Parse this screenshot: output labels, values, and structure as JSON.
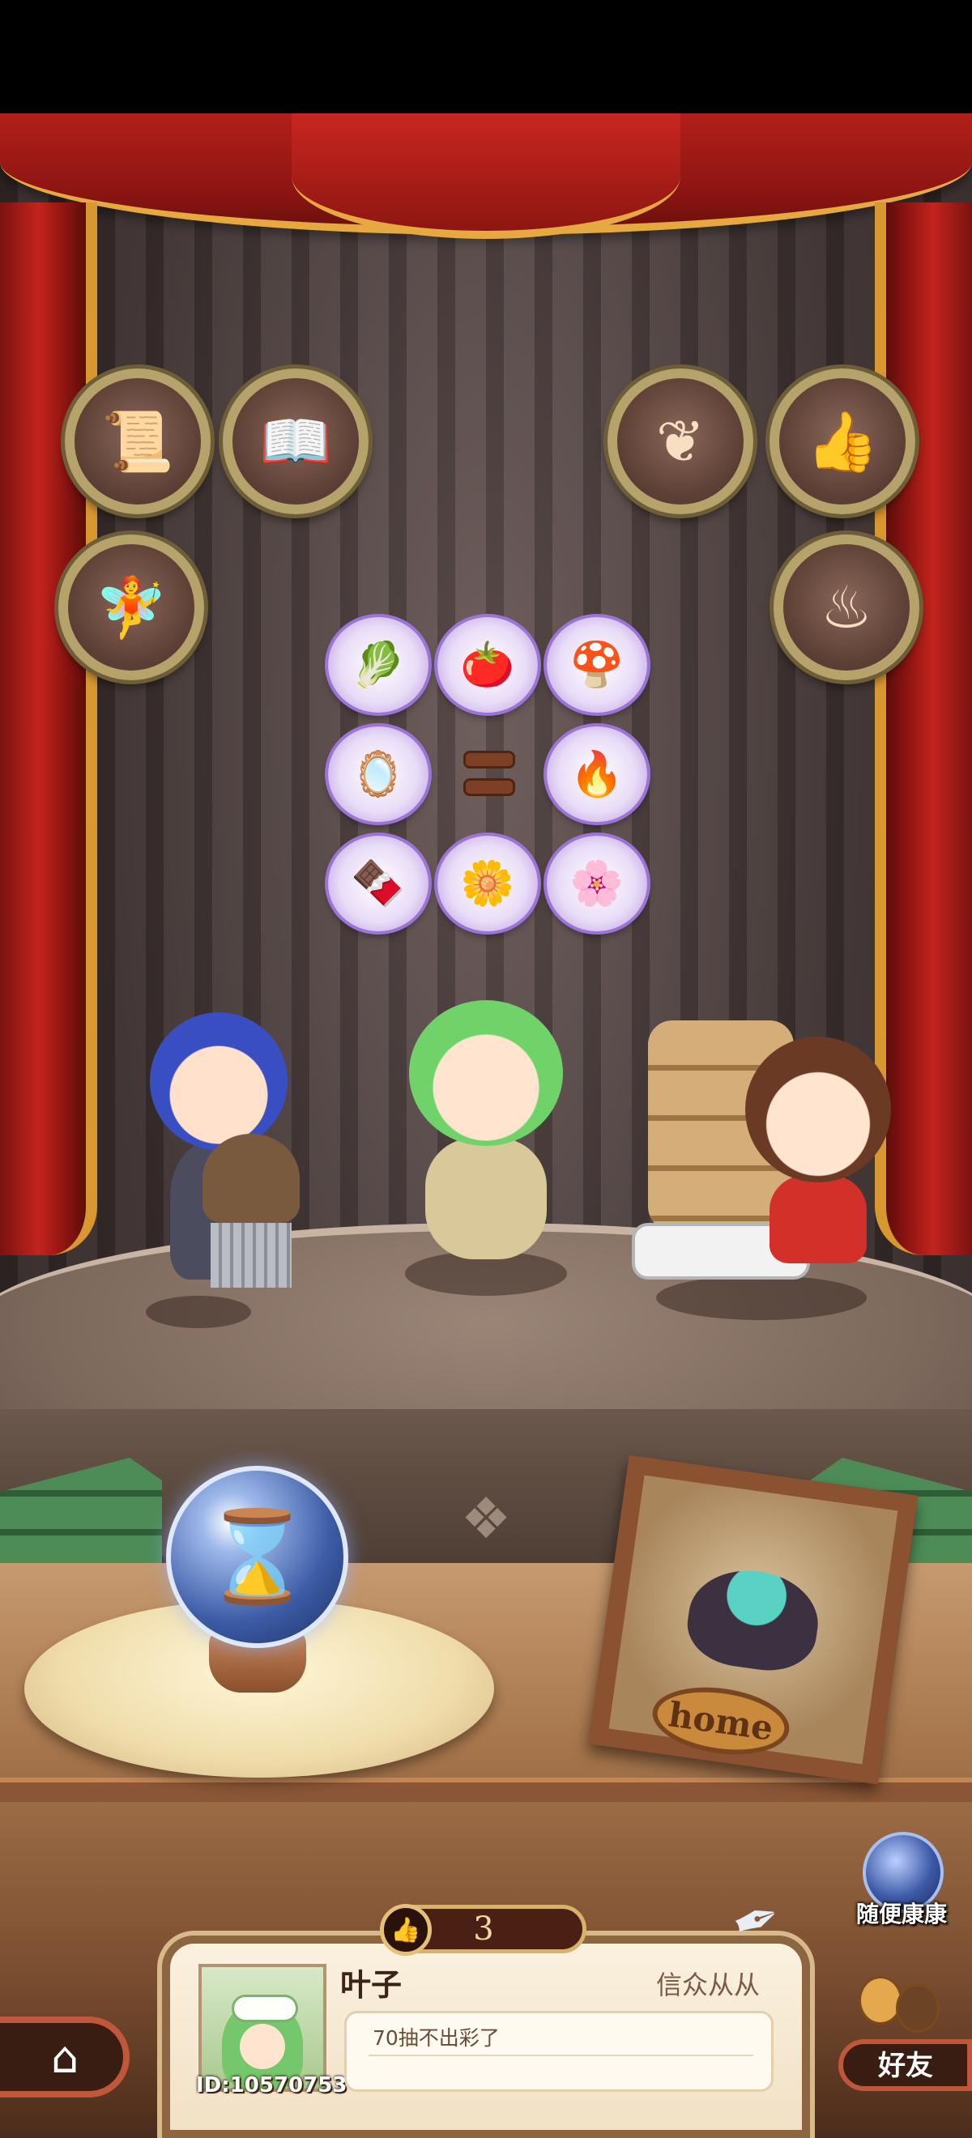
{
  "stage": {
    "badges_left": [
      {
        "icon": "certificate-icon",
        "glyph": "📜"
      },
      {
        "icon": "book-icon",
        "glyph": "📖"
      },
      {
        "icon": "fairy-icon",
        "glyph": "🧚"
      }
    ],
    "badges_right": [
      {
        "icon": "plant-ornament-icon",
        "glyph": "❦"
      },
      {
        "icon": "thumbs-up-icon",
        "glyph": "👍"
      },
      {
        "icon": "cauldron-icon",
        "glyph": "♨"
      }
    ],
    "items": [
      {
        "icon": "leek-icon",
        "glyph": "🥬"
      },
      {
        "icon": "tomato-icon",
        "glyph": "🍅"
      },
      {
        "icon": "mushroom-icon",
        "glyph": "🍄"
      },
      {
        "icon": "mirror-icon",
        "glyph": "🪞"
      },
      {
        "icon": "empty-slot-icon",
        "glyph": ""
      },
      {
        "icon": "ore-icon",
        "glyph": "🔥"
      },
      {
        "icon": "chocolate-icon",
        "glyph": "🍫"
      },
      {
        "icon": "flower-icon",
        "glyph": "🌼"
      },
      {
        "icon": "purple-flower-icon",
        "glyph": "🌸"
      }
    ]
  },
  "picture_frame": {
    "label": "home"
  },
  "random_visit": {
    "label": "随便康康"
  },
  "counter": {
    "value": "3"
  },
  "profile": {
    "name": "叶子",
    "title": "信众从从",
    "message": "70抽不出彩了",
    "id_label": "ID:10570753"
  },
  "nav": {
    "home_icon": "home-icon",
    "friends_label": "好友"
  },
  "colors": {
    "curtain": "#b21f1a",
    "trim": "#e6a940",
    "badge_border": "#b6a36c",
    "item_glow": "#9c74d9"
  }
}
